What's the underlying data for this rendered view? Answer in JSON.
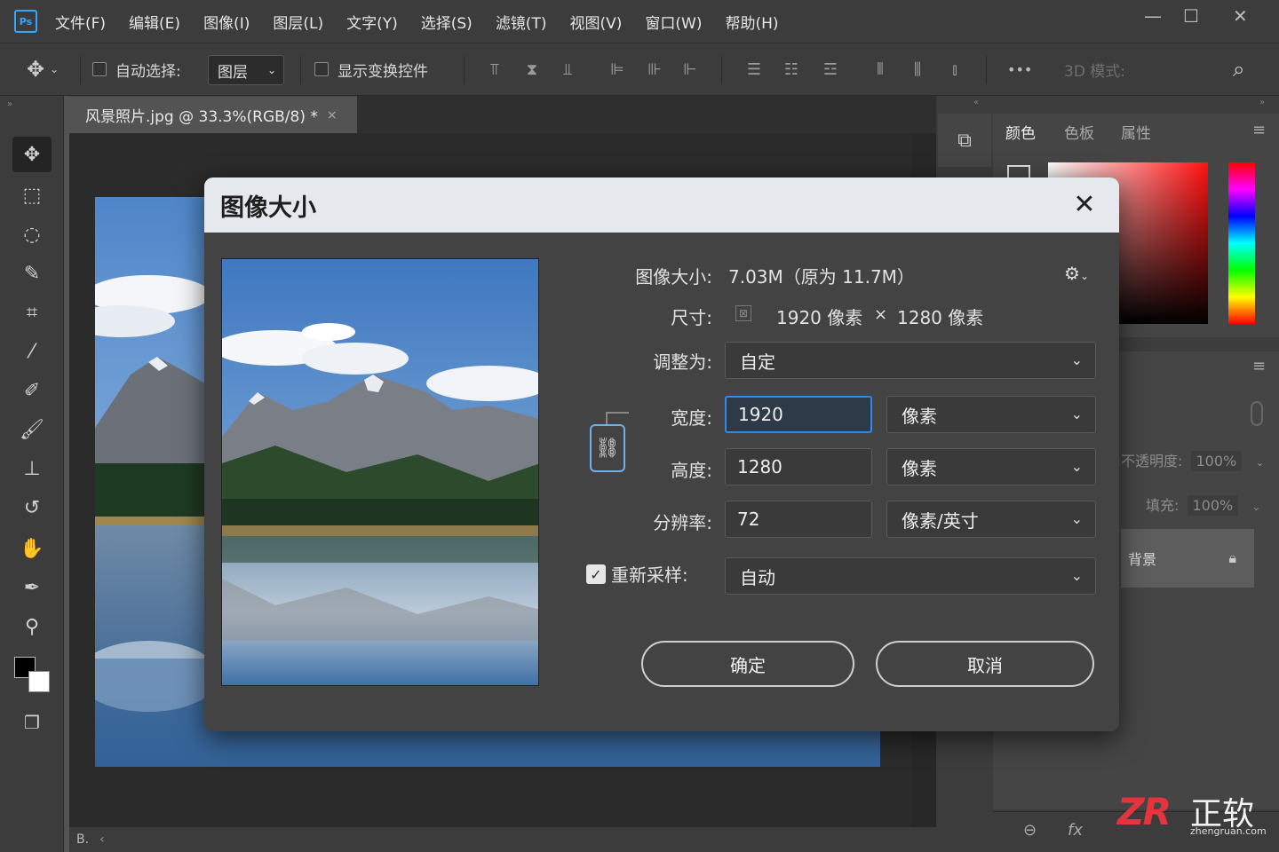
{
  "app": {
    "logo": "Ps"
  },
  "menu": [
    "文件(F)",
    "编辑(E)",
    "图像(I)",
    "图层(L)",
    "文字(Y)",
    "选择(S)",
    "滤镜(T)",
    "视图(V)",
    "窗口(W)",
    "帮助(H)"
  ],
  "window_controls": {
    "minimize": "—",
    "maximize": "☐",
    "close": "✕"
  },
  "options": {
    "auto_select_label": "自动选择:",
    "auto_select_value": "图层",
    "transform_label": "显示变换控件",
    "more": "•••",
    "mode3d": "3D 模式:"
  },
  "document": {
    "tab_title": "风景照片.jpg @ 33.3%(RGB/8) *",
    "tab_close": "×",
    "status": "B."
  },
  "panels": {
    "tabs": [
      "颜色",
      "色板",
      "属性"
    ],
    "opacity_label": "不透明度:",
    "opacity_value": "100%",
    "fill_label": "填充:",
    "fill_value": "100%",
    "background_layer": "背景",
    "bottom_link": "⊖",
    "bottom_fx": "fx"
  },
  "dialog": {
    "title": "图像大小",
    "image_size_label": "图像大小:",
    "image_size_value": "7.03M（原为 11.7M）",
    "dimensions_label": "尺寸:",
    "dim_width": "1920 像素",
    "dim_times": "×",
    "dim_height": "1280 像素",
    "fit_label": "调整为:",
    "fit_value": "自定",
    "width_label": "宽度:",
    "width_value": "1920",
    "width_unit": "像素",
    "height_label": "高度:",
    "height_value": "1280",
    "height_unit": "像素",
    "resolution_label": "分辨率:",
    "resolution_value": "72",
    "resolution_unit": "像素/英寸",
    "resample_label": "重新采样:",
    "resample_checked": true,
    "resample_value": "自动",
    "ok": "确定",
    "cancel": "取消"
  },
  "watermark": {
    "logo": "ZR",
    "text": "正软",
    "url": "zhengruan.com"
  }
}
